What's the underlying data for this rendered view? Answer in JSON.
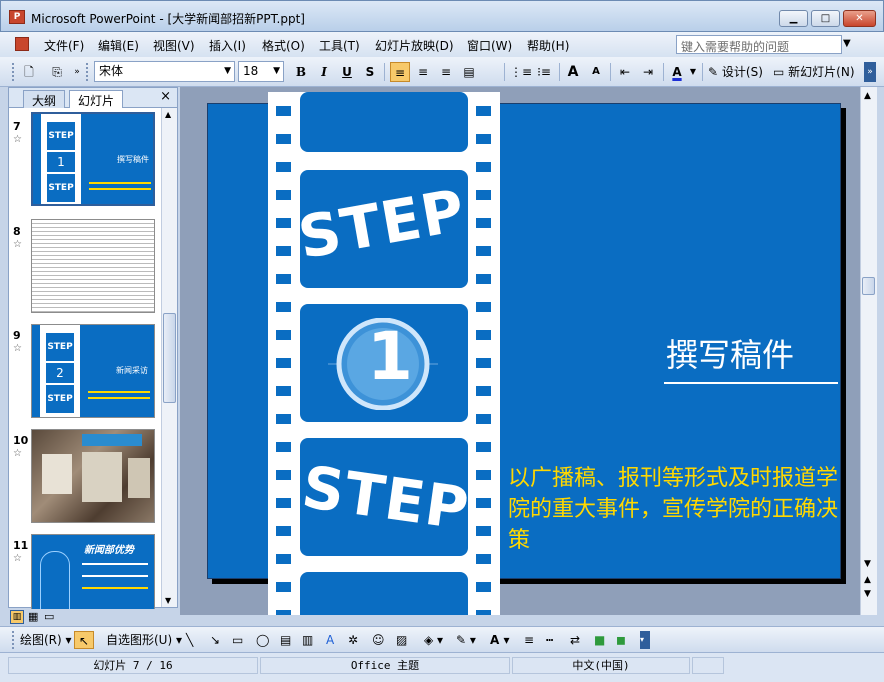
{
  "window": {
    "title": "Microsoft PowerPoint - [大学新闻部招新PPT.ppt]",
    "app_icon": "powerpoint-icon",
    "minimize": "▁",
    "maximize": "□",
    "close": "✕"
  },
  "menu": {
    "items": [
      "文件(F)",
      "编辑(E)",
      "视图(V)",
      "插入(I)",
      "格式(O)",
      "工具(T)",
      "幻灯片放映(D)",
      "窗口(W)",
      "帮助(H)"
    ],
    "help_placeholder": "键入需要帮助的问题"
  },
  "toolbar": {
    "font": "宋体",
    "size": "18",
    "bold": "B",
    "italic": "I",
    "underline": "U",
    "shadow": "S",
    "grow_font": "A",
    "shrink_font": "A",
    "font_color": "A",
    "design": "设计(S)",
    "new_slide": "新幻灯片(N)"
  },
  "left_pane": {
    "tab_outline": "大纲",
    "tab_slides": "幻灯片",
    "close": "×",
    "slides": [
      {
        "num": "7",
        "star": "☆",
        "selected": true
      },
      {
        "num": "8",
        "star": "☆",
        "selected": false
      },
      {
        "num": "9",
        "star": "☆",
        "selected": false
      },
      {
        "num": "10",
        "star": "☆",
        "selected": false
      },
      {
        "num": "11",
        "star": "☆",
        "selected": false
      }
    ],
    "thumb7_title": "撰写稿件",
    "thumb9_title": "新闻采访",
    "thumb11_title": "新闻部优势",
    "scroll_fraction": 0.58
  },
  "slide": {
    "step_top": "STEP",
    "number": "1",
    "step_bottom": "STEP",
    "title": "撰写稿件",
    "body": "以广播稿、报刊等形式及时报道学院的重大事件，宣传学院的正确决策",
    "bg_color": "#0a6dc2",
    "body_color": "#ffd800"
  },
  "drawing": {
    "draw_menu": "绘图(R)",
    "autoshapes": "自选图形(U)"
  },
  "status": {
    "slide_info": "幻灯片 7 / 16",
    "theme": "Office 主题",
    "language": "中文(中国)"
  }
}
